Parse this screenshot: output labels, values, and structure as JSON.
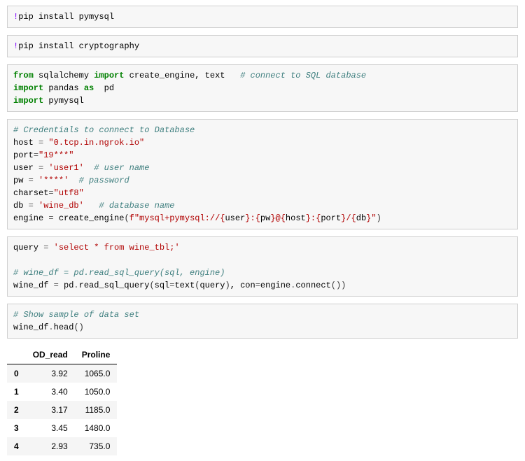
{
  "cells": {
    "c1": {
      "bang": "!",
      "cmd": "pip install pymysql"
    },
    "c2": {
      "bang": "!",
      "cmd": "pip install cryptography"
    },
    "c3": {
      "line1_from": "from",
      "line1_mod": " sqlalchemy ",
      "line1_imp": "import",
      "line1_rest": " create_engine, text   ",
      "line1_cm": "# connect to SQL database",
      "line2_imp": "import",
      "line2_rest": " pandas ",
      "line2_as": "as",
      "line2_alias": "  pd",
      "line3_imp": "import",
      "line3_rest": " pymysql"
    },
    "c4": {
      "cm1": "# Credentials to connect to Database",
      "l2a": "host ",
      "l2eq": "=",
      "l2b": " ",
      "l2s": "\"0.tcp.in.ngrok.io\"",
      "l3a": "port",
      "l3eq": "=",
      "l3s": "\"19***\"",
      "l4a": "user ",
      "l4eq": "=",
      "l4b": " ",
      "l4s": "'user1'",
      "l4cm": "  # user name",
      "l5a": "pw ",
      "l5eq": "=",
      "l5b": " ",
      "l5s": "'****'",
      "l5cm": "  # password",
      "l6a": "charset",
      "l6eq": "=",
      "l6s": "\"utf8\"",
      "l7a": "db ",
      "l7eq": "=",
      "l7b": " ",
      "l7s": "'wine_db'",
      "l7cm": "   # database name",
      "l8a": "engine ",
      "l8eq": "=",
      "l8b": " create_engine",
      "l8p1": "(",
      "l8f": "f\"mysql+pymysql://{",
      "l8u": "user",
      "l8c1": "}:{",
      "l8pw": "pw",
      "l8c2": "}@{",
      "l8h": "host",
      "l8c3": "}:{",
      "l8po": "port",
      "l8c4": "}/{",
      "l8db": "db",
      "l8c5": "}\"",
      "l8p2": ")"
    },
    "c5": {
      "l1a": "query ",
      "l1eq": "=",
      "l1b": " ",
      "l1s": "'select * from wine_tbl;'",
      "cm2": "# wine_df = pd.read_sql_query(sql, engine)",
      "l3a": "wine_df ",
      "l3eq": "=",
      "l3b": " pd",
      "l3dot1": ".",
      "l3fn1": "read_sql_query",
      "l3p1": "(",
      "l3arg1": "sql",
      "l3eq2": "=",
      "l3fn2": "text",
      "l3p2": "(",
      "l3arg2": "query",
      "l3p3": ")",
      "l3com": ", con",
      "l3eq3": "=",
      "l3arg3": "engine",
      "l3dot2": ".",
      "l3fn3": "connect",
      "l3p4": "(",
      "l3p5": ")",
      "l3p6": ")"
    },
    "c6": {
      "cm": "# Show sample of data set",
      "l2a": "wine_df",
      "l2dot": ".",
      "l2fn": "head",
      "l2p1": "(",
      "l2p2": ")"
    }
  },
  "output_table": {
    "columns": [
      "OD_read",
      "Proline"
    ],
    "index": [
      "0",
      "1",
      "2",
      "3",
      "4"
    ],
    "rows": [
      [
        "3.92",
        "1065.0"
      ],
      [
        "3.40",
        "1050.0"
      ],
      [
        "3.17",
        "1185.0"
      ],
      [
        "3.45",
        "1480.0"
      ],
      [
        "2.93",
        "735.0"
      ]
    ]
  },
  "chart_data": {
    "type": "table",
    "columns": [
      "OD_read",
      "Proline"
    ],
    "index": [
      0,
      1,
      2,
      3,
      4
    ],
    "data": [
      [
        3.92,
        1065.0
      ],
      [
        3.4,
        1050.0
      ],
      [
        3.17,
        1185.0
      ],
      [
        3.45,
        1480.0
      ],
      [
        2.93,
        735.0
      ]
    ]
  }
}
